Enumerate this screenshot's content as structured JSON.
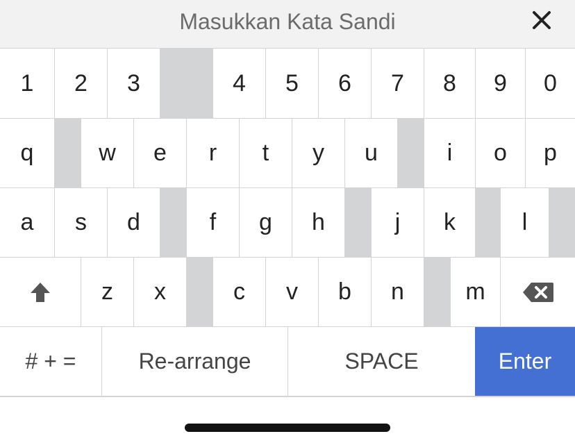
{
  "header": {
    "title": "Masukkan Kata Sandi",
    "close_icon": "close-icon"
  },
  "keyboard": {
    "rows": [
      [
        {
          "type": "key",
          "label": "1"
        },
        {
          "type": "key",
          "label": "2"
        },
        {
          "type": "key",
          "label": "3"
        },
        {
          "type": "spacer"
        },
        {
          "type": "key",
          "label": "4"
        },
        {
          "type": "key",
          "label": "5"
        },
        {
          "type": "key",
          "label": "6"
        },
        {
          "type": "key",
          "label": "7"
        },
        {
          "type": "key",
          "label": "8"
        },
        {
          "type": "key",
          "label": "9"
        },
        {
          "type": "key",
          "label": "0"
        }
      ],
      [
        {
          "type": "key",
          "label": "q"
        },
        {
          "type": "spacer"
        },
        {
          "type": "key",
          "label": "w"
        },
        {
          "type": "key",
          "label": "e"
        },
        {
          "type": "key",
          "label": "r"
        },
        {
          "type": "key",
          "label": "t"
        },
        {
          "type": "key",
          "label": "y"
        },
        {
          "type": "key",
          "label": "u"
        },
        {
          "type": "spacer"
        },
        {
          "type": "key",
          "label": "i"
        },
        {
          "type": "key",
          "label": "o"
        },
        {
          "type": "key",
          "label": "p"
        }
      ],
      [
        {
          "type": "key",
          "label": "a"
        },
        {
          "type": "key",
          "label": "s"
        },
        {
          "type": "key",
          "label": "d"
        },
        {
          "type": "spacer"
        },
        {
          "type": "key",
          "label": "f"
        },
        {
          "type": "key",
          "label": "g"
        },
        {
          "type": "key",
          "label": "h"
        },
        {
          "type": "spacer"
        },
        {
          "type": "key",
          "label": "j"
        },
        {
          "type": "key",
          "label": "k"
        },
        {
          "type": "spacer"
        },
        {
          "type": "key",
          "label": "l"
        },
        {
          "type": "spacer"
        }
      ],
      [
        {
          "type": "key",
          "label": "",
          "icon": "shift-arrow-icon"
        },
        {
          "type": "key",
          "label": "z"
        },
        {
          "type": "key",
          "label": "x"
        },
        {
          "type": "spacer"
        },
        {
          "type": "key",
          "label": "c"
        },
        {
          "type": "key",
          "label": "v"
        },
        {
          "type": "key",
          "label": "b"
        },
        {
          "type": "key",
          "label": "n"
        },
        {
          "type": "spacer"
        },
        {
          "type": "key",
          "label": "m"
        },
        {
          "type": "key",
          "label": "",
          "icon": "backspace-icon"
        }
      ],
      [
        {
          "type": "key",
          "label": "# + =",
          "role": "wide"
        },
        {
          "type": "key",
          "label": "Re-arrange",
          "role": "wide"
        },
        {
          "type": "key",
          "label": "SPACE",
          "role": "wide"
        },
        {
          "type": "key",
          "label": "Enter",
          "role": "enter"
        }
      ]
    ]
  },
  "colors": {
    "enter_key": "#4470d4",
    "spacer": "#d3d4d6",
    "header_bg": "#f2f2f3",
    "divider": "#d4d4d6"
  }
}
